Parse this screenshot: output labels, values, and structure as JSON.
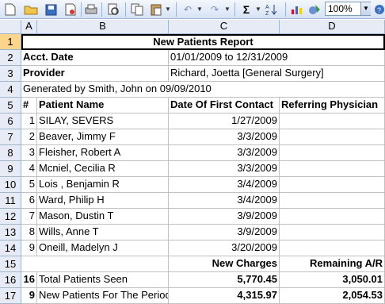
{
  "toolbar": {
    "zoom": "100%",
    "icons": [
      "new-icon",
      "open-icon",
      "save-icon",
      "permission-icon",
      "print-icon",
      "print-preview-icon",
      "copy-icon",
      "paste-icon",
      "undo-icon",
      "redo-icon",
      "autosum-icon",
      "sort-icon",
      "chart-icon",
      "drawing-icon",
      "help-icon"
    ]
  },
  "columns": [
    "A",
    "B",
    "C",
    "D"
  ],
  "rows": [
    "1",
    "2",
    "3",
    "4",
    "5",
    "6",
    "7",
    "8",
    "9",
    "10",
    "11",
    "12",
    "13",
    "14",
    "15",
    "16",
    "17"
  ],
  "report": {
    "title": "New Patients Report",
    "acct_label": "Acct. Date",
    "acct_value": "01/01/2009 to 12/31/2009",
    "provider_label": "Provider",
    "provider_value": "Richard, Joetta [General Surgery]",
    "generated": "Generated by Smith, John on 09/09/2010",
    "headers": {
      "num": "#",
      "name": "Patient Name",
      "date": "Date Of First Contact",
      "ref": "Referring Physician"
    },
    "patients": [
      {
        "num": "1",
        "name": "SILAY, SEVERS",
        "date": "1/27/2009"
      },
      {
        "num": "2",
        "name": "Beaver, Jimmy F",
        "date": "3/3/2009"
      },
      {
        "num": "3",
        "name": "Fleisher, Robert A",
        "date": "3/3/2009"
      },
      {
        "num": "4",
        "name": "Mcniel, Cecilia R",
        "date": "3/3/2009"
      },
      {
        "num": "5",
        "name": "Lois , Benjamin R",
        "date": "3/4/2009"
      },
      {
        "num": "6",
        "name": "Ward, Philip H",
        "date": "3/4/2009"
      },
      {
        "num": "7",
        "name": "Mason, Dustin T",
        "date": "3/9/2009"
      },
      {
        "num": "8",
        "name": "Wills, Anne T",
        "date": "3/9/2009"
      },
      {
        "num": "9",
        "name": "Oneill, Madelyn J",
        "date": "3/20/2009"
      }
    ],
    "new_charges_label": "New Charges",
    "remaining_label": "Remaining A/R",
    "total_count": "16",
    "total_label": "Total Patients Seen",
    "total_charges": "5,770.45",
    "total_remaining": "3,050.01",
    "new_count": "9",
    "new_label": "New Patients For The Period",
    "new_charges": "4,315.97",
    "new_remaining": "2,054.53"
  }
}
